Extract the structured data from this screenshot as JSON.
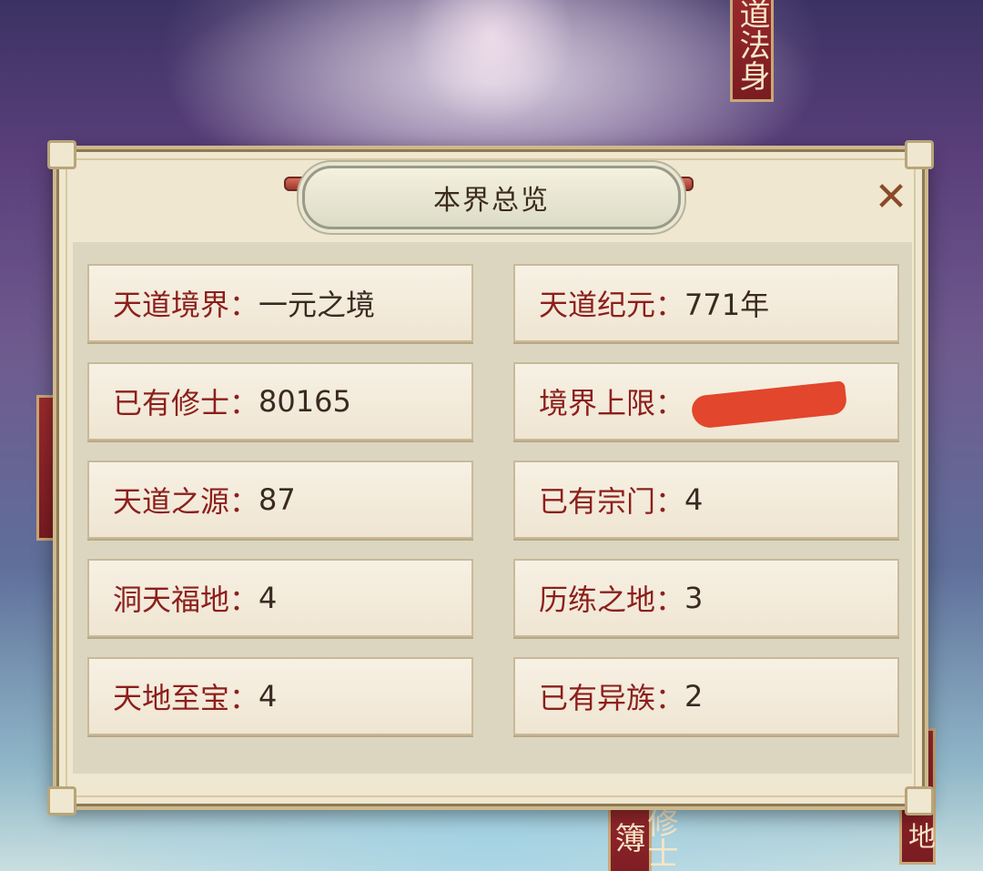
{
  "background": {
    "banners": {
      "top_right": "道法身",
      "bottom_center": "修士簿",
      "bottom_right": "地"
    }
  },
  "dialog": {
    "title": "本界总览",
    "close_icon": "close-icon",
    "stats": [
      {
        "label": "天道境界：",
        "value": "一元之境"
      },
      {
        "label": "天道纪元：",
        "value": "771年"
      },
      {
        "label": "已有修士：",
        "value": "80165"
      },
      {
        "label": "境界上限：",
        "value": ""
      },
      {
        "label": "天道之源：",
        "value": "87"
      },
      {
        "label": "已有宗门：",
        "value": "4"
      },
      {
        "label": "洞天福地：",
        "value": "4"
      },
      {
        "label": "历练之地：",
        "value": "3"
      },
      {
        "label": "天地至宝：",
        "value": "4"
      },
      {
        "label": "已有异族：",
        "value": "2"
      }
    ]
  }
}
